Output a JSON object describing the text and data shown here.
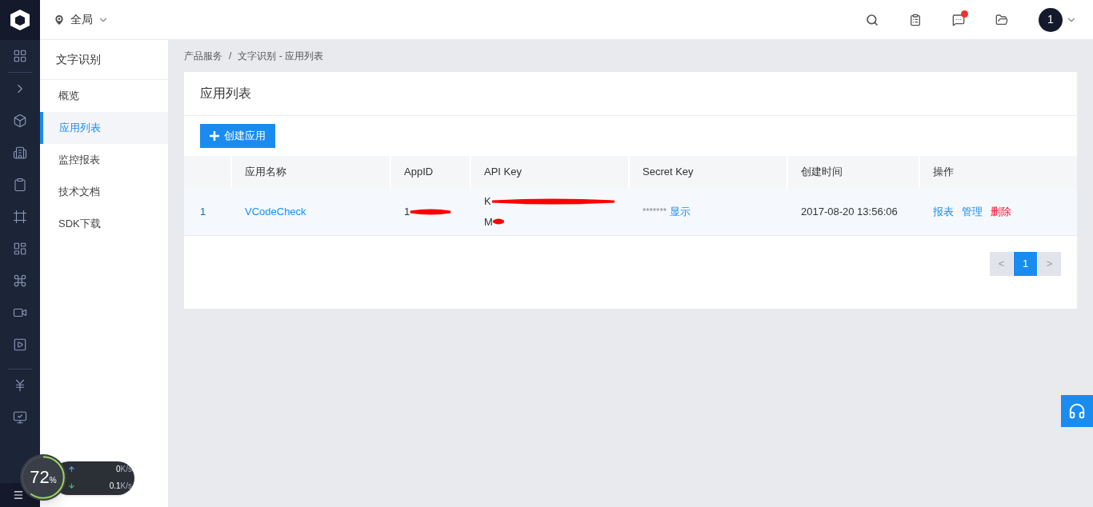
{
  "top_bar": {
    "location": "全局",
    "notifications_unread": true,
    "avatar": "1"
  },
  "sidebar": {
    "title": "文字识别",
    "items": [
      {
        "label": "概览",
        "selected": false
      },
      {
        "label": "应用列表",
        "selected": true
      },
      {
        "label": "监控报表",
        "selected": false
      },
      {
        "label": "技术文档",
        "selected": false
      },
      {
        "label": "SDK下载",
        "selected": false
      }
    ]
  },
  "breadcrumb": [
    "产品服务",
    "/",
    "文字识别 - 应用列表"
  ],
  "card": {
    "title": "应用列表",
    "create_button": "创建应用",
    "table": {
      "columns": [
        "",
        "应用名称",
        "AppID",
        "API Key",
        "Secret Key",
        "创建时间",
        "操作"
      ],
      "rows": [
        {
          "index": "1",
          "name": "VCodeCheck",
          "app_id": "1",
          "api_key": [
            "K",
            "M"
          ],
          "secret_key": "*******",
          "show_link": "显示",
          "created": "2017-08-20 13:56:06",
          "actions": [
            {
              "label": "报表",
              "kind": "normal"
            },
            {
              "label": "管理",
              "kind": "normal"
            },
            {
              "label": "删除",
              "kind": "danger"
            }
          ]
        }
      ]
    }
  },
  "pagination": {
    "prev": "<",
    "pages": [
      {
        "label": "1",
        "selected": true
      }
    ],
    "next": ">"
  },
  "network_widget": {
    "percent": "72",
    "percent_sign": "%",
    "upload": "0",
    "upload_unit": "K/s",
    "download": "0.1",
    "download_unit": "K/s"
  }
}
